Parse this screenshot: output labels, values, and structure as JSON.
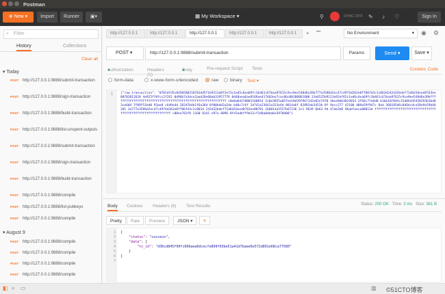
{
  "window": {
    "title": "Postman"
  },
  "toolbar": {
    "new_label": "New",
    "import_label": "Import",
    "runner_label": "Runner",
    "workspace": "My Workspace",
    "sync_label": "SYNC OFF",
    "signin_label": "Sign In"
  },
  "sidebar": {
    "filter_placeholder": "Filter",
    "tab_history": "History",
    "tab_collections": "Collections",
    "clear_all": "Clear all",
    "groups": [
      {
        "label": "Today",
        "items": [
          {
            "method": "POST",
            "url": "http://127.0.0.1:9888/submit-transaction"
          },
          {
            "method": "POST",
            "url": "http://127.0.0.1:9888/sign-transaction"
          },
          {
            "method": "POST",
            "url": "http://127.0.0.1:9888/build-transaction"
          },
          {
            "method": "POST",
            "url": "http://127.0.0.1:9888/list-unspent-outputs"
          },
          {
            "method": "POST",
            "url": "http://127.0.0.1:9888/submit-transaction"
          },
          {
            "method": "POST",
            "url": "http://127.0.0.1:9888/sign-transaction"
          },
          {
            "method": "POST",
            "url": "http://127.0.0.1:9888/build-transaction"
          },
          {
            "method": "POST",
            "url": "http://127.0.0.1:9888/compile"
          },
          {
            "method": "POST",
            "url": "http://127.0.0.1:9888/list-pubkeys"
          },
          {
            "method": "POST",
            "url": "http://127.0.0.1:9888/compile"
          }
        ]
      },
      {
        "label": "August 9",
        "items": [
          {
            "method": "POST",
            "url": "http://127.0.0.1:9888/compile"
          },
          {
            "method": "POST",
            "url": "http://127.0.0.1:9888/compile"
          },
          {
            "method": "POST",
            "url": "http://127.0.0.1:9888/compile"
          },
          {
            "method": "POST",
            "url": "http://127.0.0.1:9888/compile"
          }
        ]
      }
    ]
  },
  "request_tabs": [
    "http://127.0.0.1",
    "http://127.0.0.1",
    "http://127.0.0.1",
    "http://127.0.0.1",
    "http://127.0.0.1"
  ],
  "environment": "No Environment",
  "request": {
    "method": "POST",
    "url": "http://127.0.0.1:9888/submit-transaction",
    "params_label": "Params",
    "send_label": "Send",
    "save_label": "Save"
  },
  "req_tabs": {
    "authorization": "Authorization",
    "headers": "Headers (1)",
    "body": "Body",
    "prerequest": "Pre-request Script",
    "tests": "Tests",
    "cookies": "Cookies",
    "code": "Code"
  },
  "body_options": {
    "form_data": "form-data",
    "urlencoded": "x-www-form-urlencoded",
    "raw": "raw",
    "binary": "binary",
    "text": "Text"
  },
  "request_body": "{\"raw_transaction\": \"0701dfd5c8d50580216f01dd5f1b9213a0f2ef3c1ed5c6ea69fc3b461c67baa97615c9ce9ee548d6e39b777e3586d2ec47c4974d262e0ff86fd3c1c063d242d32bdef71d6d16eed8763ee80702012620 4e925ff0fcc2f261 0d96b7a3dce2aad28e60ab33957776 0d48aea6ae8169ae417403ee7cac06c00180061600 31e6525b9213a92ef65c1ed6c4ea69fc3b461c67baa97615c9ce9ee548d6e39bffffffffffffffffffffffffffffffffffffffffffffffffffffffffffff c0e0a6d1f0001160814 2c0e3055a05fee18d39f9b71d2e02e74f0 3bea9db3024034 3f66c7fa6d0 b1bb16f844c15d04445458293b3bd83ce604 7f09f51bd0 93ae0 c6d9a4d 282d7b4b1f6a36d 0f00bdd2a2de b40c7c6f 2d741e23641a323e4d 0014a6f 82892eb3453b 8f 9ecc277 42100 d09a59f947c 8ad 360185d6c046dcdca58e9a59b48201 3a777e3586d2ec47c4974d262e0ff86fd3c1c063d 242d32bdef71d6d16eed8763ee80701 160814a5557b67236 2c1 9639 6b63 9d 47ab2b0 96abfaeca00013d ffffffffffffffffffffffffffffffffffffffffffffffffffffffffffff c00ee781f0 1160 0141 e97a 8096 8fe5adbff9d12cf348a0dda6e3970d00\"}",
  "response": {
    "tab_body": "Body",
    "tab_cookies": "Cookies",
    "tab_headers": "Headers (8)",
    "tab_tests": "Test Results",
    "status_label": "Status:",
    "status_value": "200 OK",
    "time_label": "Time:",
    "time_value": "3 ms",
    "size_label": "Size:",
    "size_value": "361 B",
    "view_pretty": "Pretty",
    "view_raw": "Raw",
    "view_preview": "Preview",
    "format": "JSON",
    "lines": [
      "1",
      "2",
      "3",
      "4",
      "5",
      "6",
      "7"
    ],
    "status_key": "\"status\"",
    "status_val": "\"success\"",
    "data_key": "\"data\"",
    "txid_key": "\"tx_id\"",
    "txid_val": "\"d36cd845f90fc666aea6dcecfe899f03be51a41d7baee6e572d891e68ca77580\""
  },
  "statusbar": {
    "watermark": "©51CTO博客"
  }
}
